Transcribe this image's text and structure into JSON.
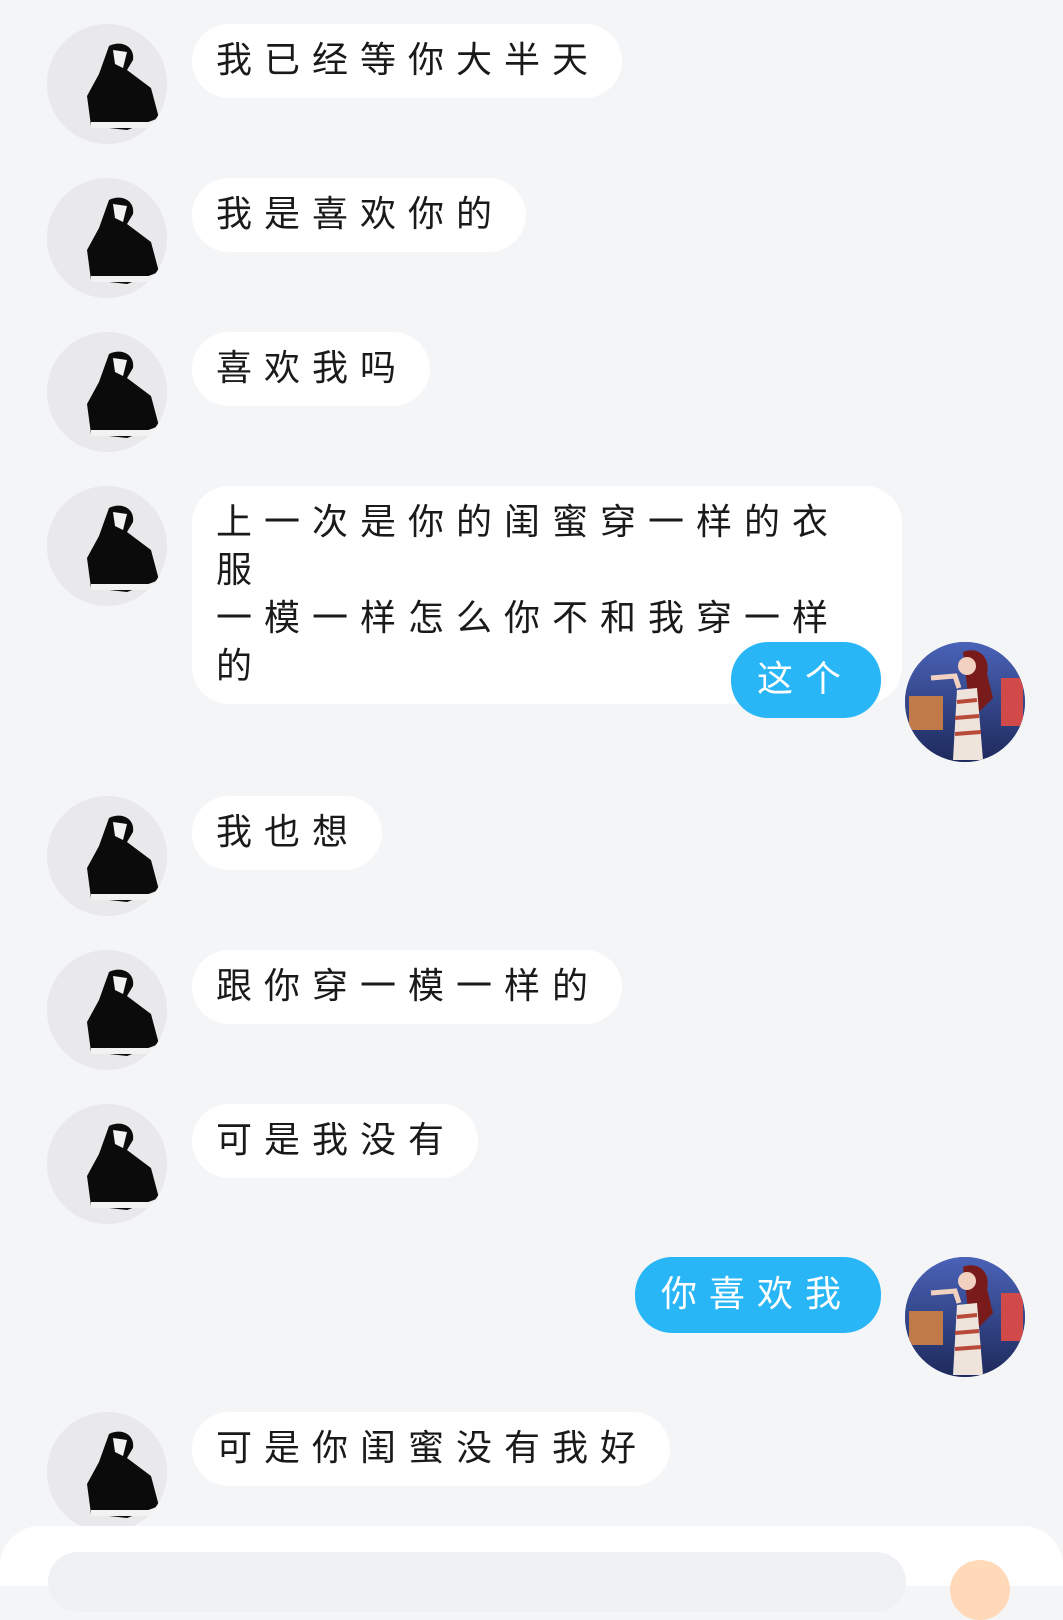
{
  "messages": [
    {
      "side": "in",
      "text": "我已经等你大半天"
    },
    {
      "side": "in",
      "text": "我是喜欢你的"
    },
    {
      "side": "in",
      "text": "喜欢我吗"
    },
    {
      "side": "in",
      "text": "上一次是你的闺蜜穿一样的衣服\n一模一样怎么你不和我穿一样的"
    },
    {
      "side": "out",
      "text": "这个"
    },
    {
      "side": "in",
      "text": "我也想"
    },
    {
      "side": "in",
      "text": "跟你穿一模一样的"
    },
    {
      "side": "in",
      "text": "可是我没有"
    },
    {
      "side": "out",
      "text": "你喜欢我"
    },
    {
      "side": "in",
      "text": "可是你闺蜜没有我好"
    }
  ],
  "colors": {
    "background": "#f4f5f7",
    "incoming_bubble": "#ffffff",
    "outgoing_bubble": "#29b6f6"
  }
}
